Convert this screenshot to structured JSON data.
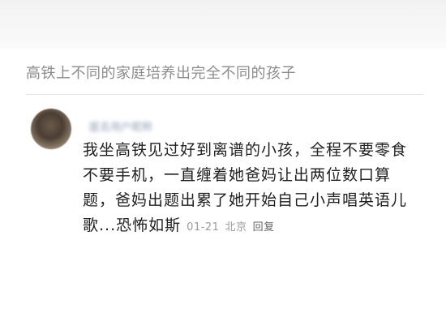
{
  "post": {
    "title": "高铁上不同的家庭培养出完全不同的孩子"
  },
  "comment": {
    "username": "匿名用户昵称",
    "lines": [
      "我坐高铁见过好到离谱的小孩，全程不要零食",
      "不要手机，一直缠着她爸妈让出两位数口算",
      "题，爸妈出题出累了她开始自己小声唱英语儿",
      "歌...恐怖如斯"
    ],
    "date": "01-21",
    "location": "北京",
    "reply_label": "回复"
  }
}
